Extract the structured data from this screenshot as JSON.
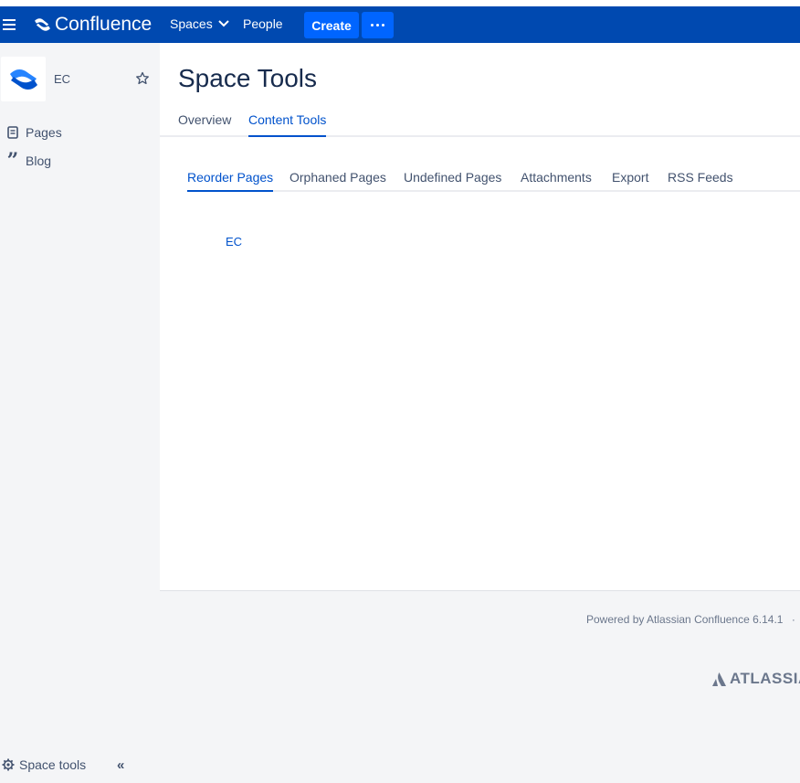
{
  "topbar": {
    "brand": "Confluence",
    "nav_spaces": "Spaces",
    "nav_people": "People",
    "create_label": "Create",
    "colors": {
      "bar": "#0049b0",
      "button": "#0065ff"
    }
  },
  "sidebar": {
    "space_name": "EC",
    "items": [
      {
        "label": "Pages",
        "icon": "page-icon"
      },
      {
        "label": "Blog",
        "icon": "quote-icon"
      }
    ],
    "space_tools_label": "Space tools",
    "collapse_glyph": "«"
  },
  "main": {
    "title": "Space Tools",
    "tabs": [
      {
        "label": "Overview",
        "active": false
      },
      {
        "label": "Content Tools",
        "active": true
      }
    ],
    "subtabs": [
      {
        "label": "Reorder Pages",
        "active": true
      },
      {
        "label": "Orphaned Pages",
        "active": false
      },
      {
        "label": "Undefined Pages",
        "active": false
      },
      {
        "label": "Attachments",
        "active": false
      },
      {
        "label": "Export",
        "active": false
      },
      {
        "label": "RSS Feeds",
        "active": false
      }
    ],
    "tree_root": "EC"
  },
  "footer": {
    "powered_by": "Powered by Atlassian Confluence 6.14.1",
    "separator": "·",
    "atlassian_logo_text": "ATLASSIAN"
  }
}
